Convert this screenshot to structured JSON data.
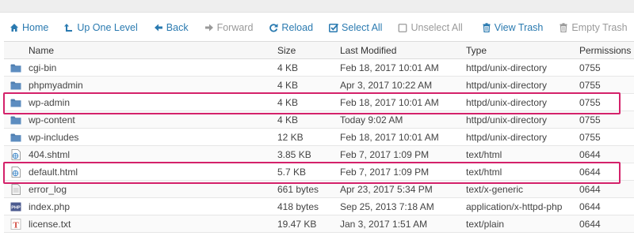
{
  "toolbar": {
    "home": "Home",
    "up": "Up One Level",
    "back": "Back",
    "forward": "Forward",
    "reload": "Reload",
    "select_all": "Select All",
    "unselect_all": "Unselect All",
    "view_trash": "View Trash",
    "empty_trash": "Empty Trash"
  },
  "columns": {
    "name": "Name",
    "size": "Size",
    "modified": "Last Modified",
    "type": "Type",
    "permissions": "Permissions"
  },
  "files": [
    {
      "icon": "folder-icon",
      "name": "cgi-bin",
      "size": "4 KB",
      "modified": "Feb 18, 2017 10:01 AM",
      "type": "httpd/unix-directory",
      "perms": "0755",
      "highlighted": false
    },
    {
      "icon": "folder-icon",
      "name": "phpmyadmin",
      "size": "4 KB",
      "modified": "Apr 3, 2017 10:22 AM",
      "type": "httpd/unix-directory",
      "perms": "0755",
      "highlighted": false
    },
    {
      "icon": "folder-icon",
      "name": "wp-admin",
      "size": "4 KB",
      "modified": "Feb 18, 2017 10:01 AM",
      "type": "httpd/unix-directory",
      "perms": "0755",
      "highlighted": true
    },
    {
      "icon": "folder-icon",
      "name": "wp-content",
      "size": "4 KB",
      "modified": "Today 9:02 AM",
      "type": "httpd/unix-directory",
      "perms": "0755",
      "highlighted": false
    },
    {
      "icon": "folder-icon",
      "name": "wp-includes",
      "size": "12 KB",
      "modified": "Feb 18, 2017 10:01 AM",
      "type": "httpd/unix-directory",
      "perms": "0755",
      "highlighted": false
    },
    {
      "icon": "html-file-icon",
      "name": "404.shtml",
      "size": "3.85 KB",
      "modified": "Feb 7, 2017 1:09 PM",
      "type": "text/html",
      "perms": "0644",
      "highlighted": false
    },
    {
      "icon": "html-file-icon",
      "name": "default.html",
      "size": "5.7 KB",
      "modified": "Feb 7, 2017 1:09 PM",
      "type": "text/html",
      "perms": "0644",
      "highlighted": true
    },
    {
      "icon": "generic-file-icon",
      "name": "error_log",
      "size": "661 bytes",
      "modified": "Apr 23, 2017 5:34 PM",
      "type": "text/x-generic",
      "perms": "0644",
      "highlighted": false
    },
    {
      "icon": "php-file-icon",
      "name": "index.php",
      "size": "418 bytes",
      "modified": "Sep 25, 2013 7:18 AM",
      "type": "application/x-httpd-php",
      "perms": "0644",
      "highlighted": false
    },
    {
      "icon": "text-file-icon",
      "name": "license.txt",
      "size": "19.47 KB",
      "modified": "Jan 3, 2017 1:51 AM",
      "type": "text/plain",
      "perms": "0644",
      "highlighted": false
    }
  ],
  "colors": {
    "link": "#2a7ab0",
    "disabled": "#9a9a9a",
    "highlight": "#d4216a",
    "folder": "#4f7fb0"
  }
}
